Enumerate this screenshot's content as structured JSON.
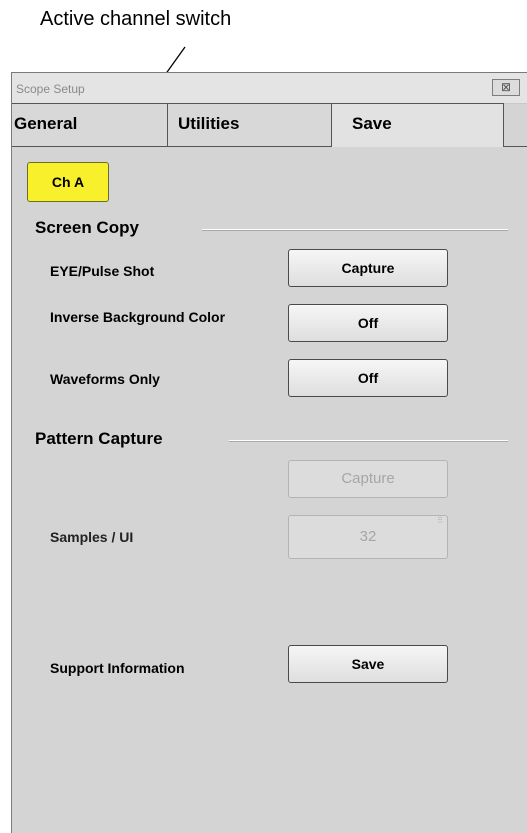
{
  "annotation": {
    "text": "Active channel switch"
  },
  "window": {
    "title": "Scope Setup",
    "close_symbol": "⊠"
  },
  "tabs": [
    {
      "label": "General"
    },
    {
      "label": "Utilities"
    },
    {
      "label": "Save"
    }
  ],
  "active_tab": "Save",
  "channel": {
    "label": "Ch A",
    "color": "#f8f02a"
  },
  "screen_copy": {
    "title": "Screen Copy",
    "rows": [
      {
        "label": "EYE/Pulse Shot",
        "button": "Capture"
      },
      {
        "label": "Inverse Background Color",
        "button": "Off"
      },
      {
        "label": "Waveforms Only",
        "button": "Off"
      }
    ]
  },
  "pattern_capture": {
    "title": "Pattern Capture",
    "capture_button": "Capture",
    "samples_label": "Samples / UI",
    "samples_value": "32"
  },
  "support": {
    "label": "Support Information",
    "button": "Save"
  }
}
